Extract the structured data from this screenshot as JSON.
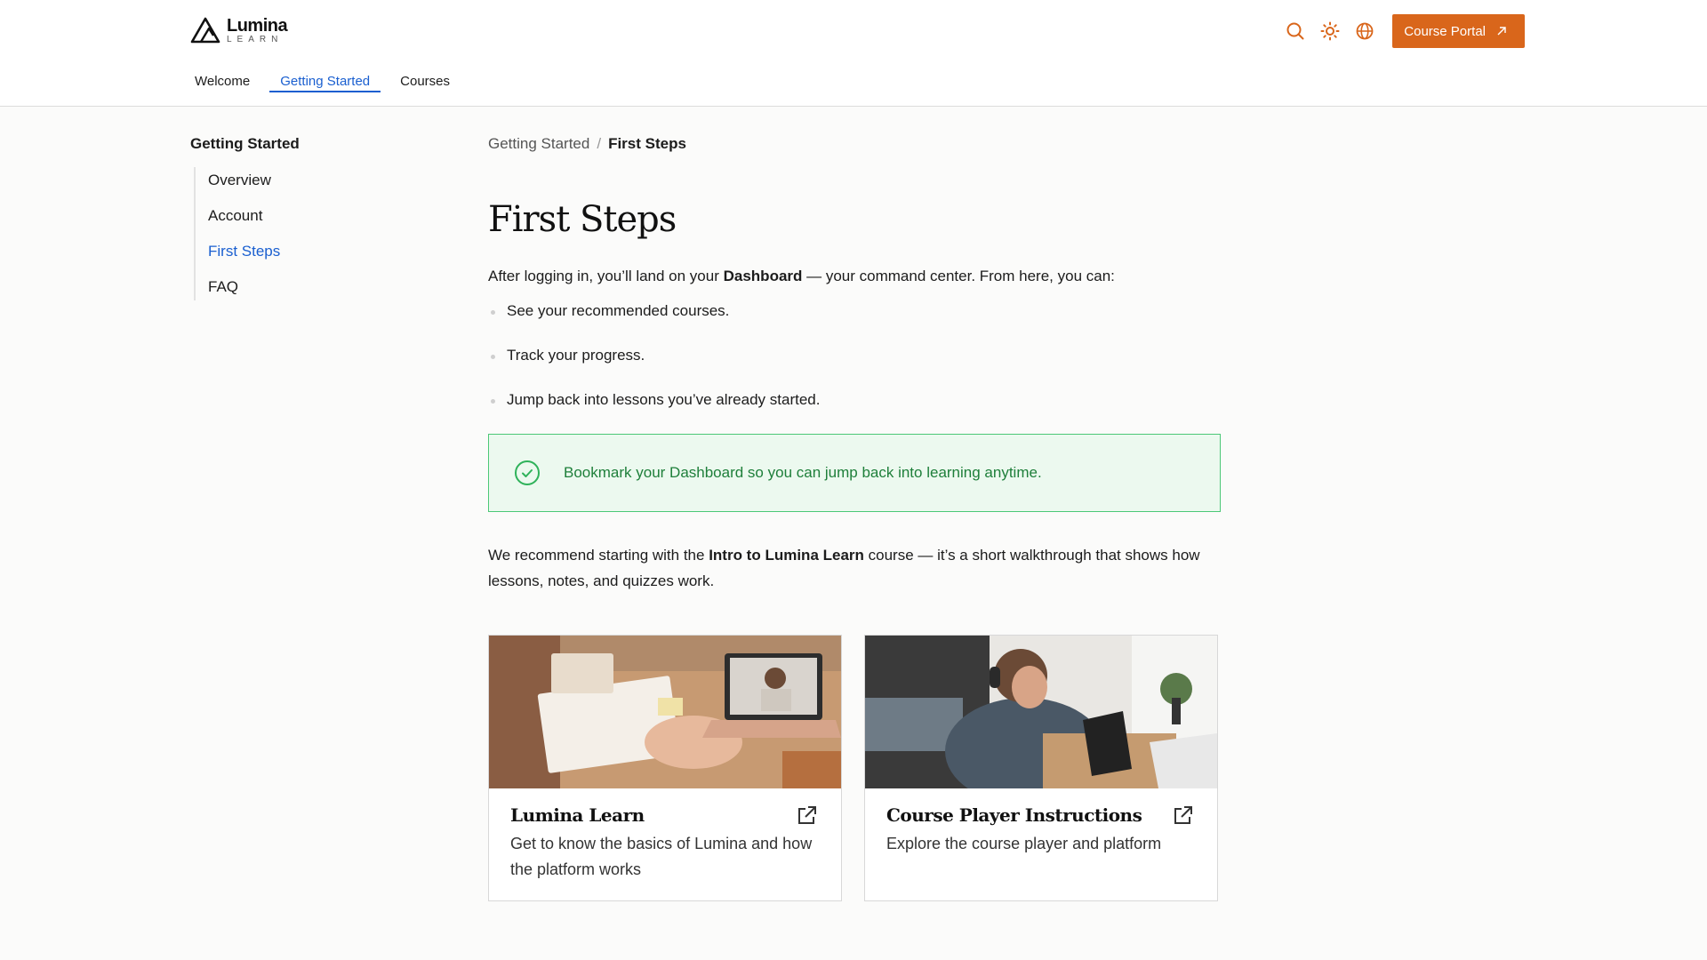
{
  "brand": {
    "name": "Lumina",
    "sub": "LEARN"
  },
  "header": {
    "portal_label": "Course Portal",
    "icons": [
      "search-icon",
      "sun-icon",
      "globe-icon"
    ],
    "accent_color": "#d9661b"
  },
  "topnav": {
    "items": [
      {
        "label": "Welcome",
        "active": false
      },
      {
        "label": "Getting Started",
        "active": true
      },
      {
        "label": "Courses",
        "active": false
      }
    ]
  },
  "sidebar": {
    "title": "Getting Started",
    "items": [
      {
        "label": "Overview",
        "active": false
      },
      {
        "label": "Account",
        "active": false
      },
      {
        "label": "First Steps",
        "active": true
      },
      {
        "label": "FAQ",
        "active": false
      }
    ]
  },
  "breadcrumb": {
    "parent": "Getting Started",
    "separator": "/",
    "current": "First Steps"
  },
  "page": {
    "title": "First Steps",
    "intro_before": "After logging in, you’ll land on your ",
    "intro_bold": "Dashboard",
    "intro_after": " — your command center. From here, you can:",
    "bullets": [
      "See your recommended courses.",
      "Track your progress.",
      "Jump back into lessons you’ve already started."
    ],
    "callout": "Bookmark your Dashboard so you can jump back into learning anytime.",
    "recommend_before": "We recommend starting with the ",
    "recommend_bold": "Intro to Lumina Learn",
    "recommend_after": " course — it’s a short walkthrough that shows how lessons, notes, and quizzes work."
  },
  "cards": [
    {
      "title": "Lumina Learn",
      "description": "Get to know the basics of Lumina and how the platform works",
      "icon": "external-link-icon"
    },
    {
      "title": "Course Player Instructions",
      "description": "Explore the course player and platform",
      "icon": "external-link-icon"
    }
  ]
}
